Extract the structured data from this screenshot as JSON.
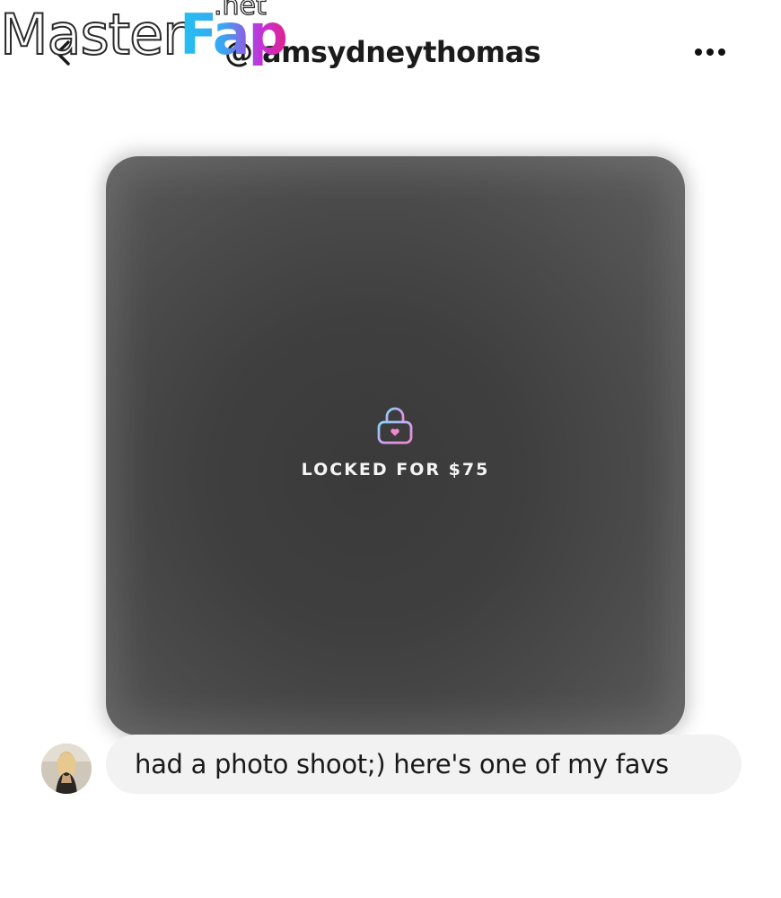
{
  "header": {
    "username": "@iamsydneythomas",
    "back_icon": "chevron-left-icon",
    "more_icon": "more-horizontal-icon"
  },
  "watermark": {
    "word1": "Master",
    "word2": "Fap",
    "suffix": ".net"
  },
  "post": {
    "locked_label": "LOCKED FOR $75",
    "lock_icon": "lock-heart-icon",
    "lock_gradient": [
      "#7fd7f5",
      "#c9a4f0",
      "#f08ad0"
    ]
  },
  "message": {
    "text": "had a photo shoot;) here's one of my favs",
    "avatar_icon": "avatar-image"
  },
  "colors": {
    "background": "#ffffff",
    "bubble": "#f2f2f2",
    "card": "#444444",
    "text": "#1a1a1a"
  }
}
